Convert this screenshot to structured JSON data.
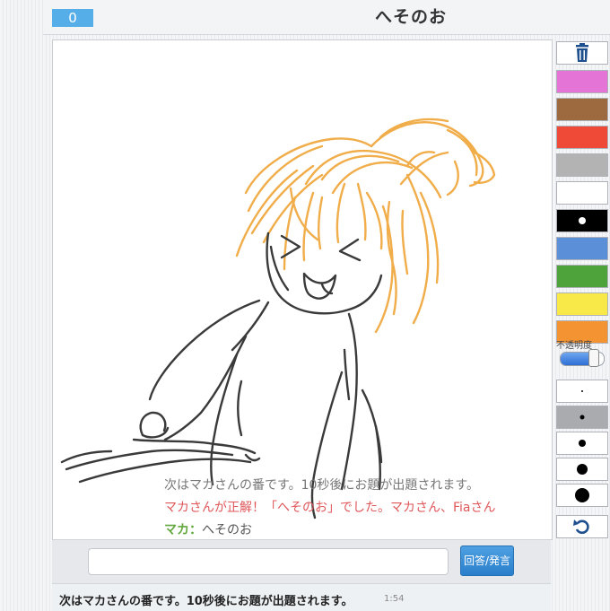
{
  "header": {
    "score": "0",
    "title": "へそのお"
  },
  "overlay_messages": {
    "line1": "次はマカさんの番です。10秒後にお題が出題されます。",
    "line2": "マカさんが正解！「へそのお」でした。マカさん、Fiaさん",
    "line3_name": "マカ",
    "line3_sep": "：",
    "line3_text": "へそのお"
  },
  "tools": {
    "trash_icon": "trash-icon",
    "colors": [
      "#e474d6",
      "#9c6a3e",
      "#ef4a37",
      "#b3b3b3",
      "#ffffff",
      "#000000",
      "#5b8fd8",
      "#4ea33b",
      "#f8e948",
      "#f39331"
    ],
    "selected_color": "#000000",
    "opacity_label": "不透明度",
    "opacity_value": 0.7,
    "brush_sizes": [
      "size-1",
      "size-2",
      "size-3",
      "size-4",
      "size-5"
    ],
    "selected_size": "size-2",
    "undo_icon": "undo-icon"
  },
  "composer": {
    "input_value": "",
    "submit_label": "回答/発言"
  },
  "log": {
    "text": "次はマカさんの番です。10秒後にお題が出題されます。",
    "time": "1:54"
  }
}
